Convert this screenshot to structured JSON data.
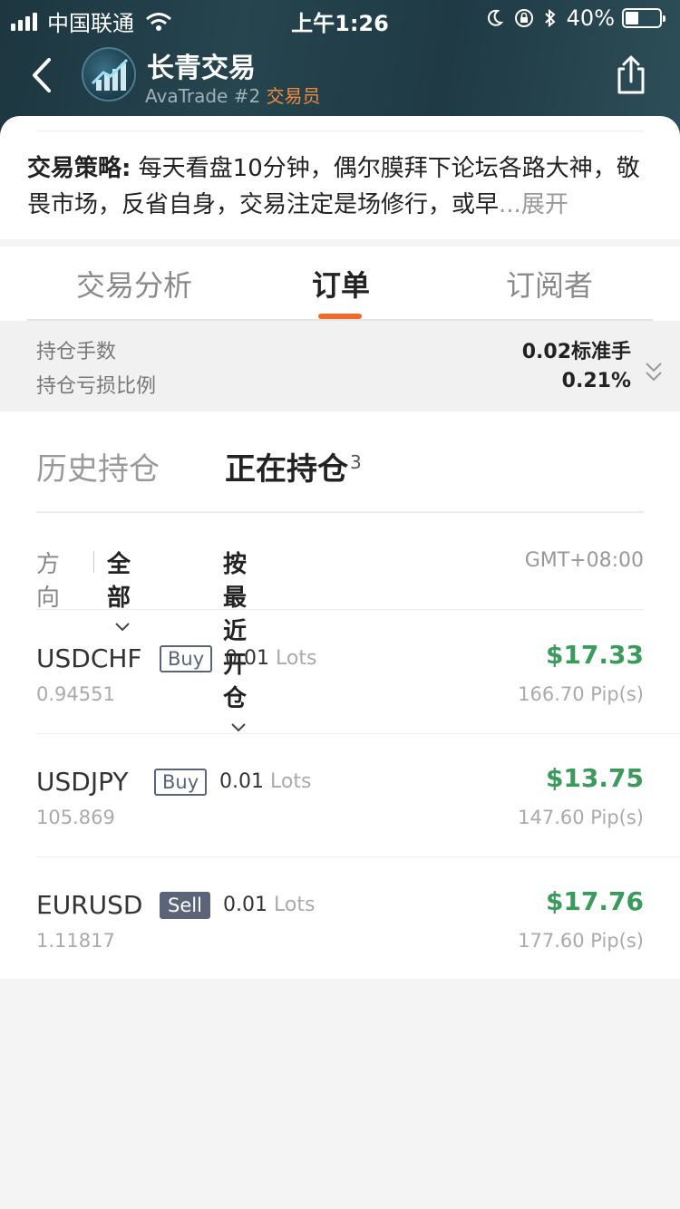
{
  "status_bar": {
    "carrier": "中国联通",
    "time": "上午1:26",
    "battery": "40%"
  },
  "header": {
    "title": "长青交易",
    "broker": "AvaTrade #2",
    "role": "交易员"
  },
  "strategy": {
    "label": "交易策略:",
    "text": "每天看盘10分钟，偶尔膜拜下论坛各路大神，敬畏市场，反省自身，交易注定是场修行，或早",
    "ellipsis": "...",
    "more": "展开"
  },
  "tabs": [
    {
      "label": "交易分析",
      "active": false
    },
    {
      "label": "订单",
      "active": true
    },
    {
      "label": "订阅者",
      "active": false
    }
  ],
  "summary": {
    "lots_label": "持仓手数",
    "lots_value": "0.02标准手",
    "ratio_label": "持仓亏损比例",
    "ratio_value": "0.21%"
  },
  "subtabs": {
    "history": "历史持仓",
    "open": "正在持仓",
    "open_count": "3"
  },
  "filters": {
    "direction_label": "方向",
    "direction_value": "全部",
    "sort_value": "按最近开仓",
    "timezone": "GMT+08:00"
  },
  "orders": [
    {
      "symbol": "USDCHF",
      "side": "Buy",
      "lots": "0.01",
      "lots_unit": "Lots",
      "open_price": "0.94551",
      "profit": "$17.33",
      "pips": "166.70 Pip(s)"
    },
    {
      "symbol": "USDJPY",
      "side": "Buy",
      "lots": "0.01",
      "lots_unit": "Lots",
      "open_price": "105.869",
      "profit": "$13.75",
      "pips": "147.60 Pip(s)"
    },
    {
      "symbol": "EURUSD",
      "side": "Sell",
      "lots": "0.01",
      "lots_unit": "Lots",
      "open_price": "1.11817",
      "profit": "$17.76",
      "pips": "177.60 Pip(s)"
    }
  ],
  "colors": {
    "accent": "#ef6a2b",
    "profit": "#3a9b5c",
    "badge": "#5b6478"
  }
}
